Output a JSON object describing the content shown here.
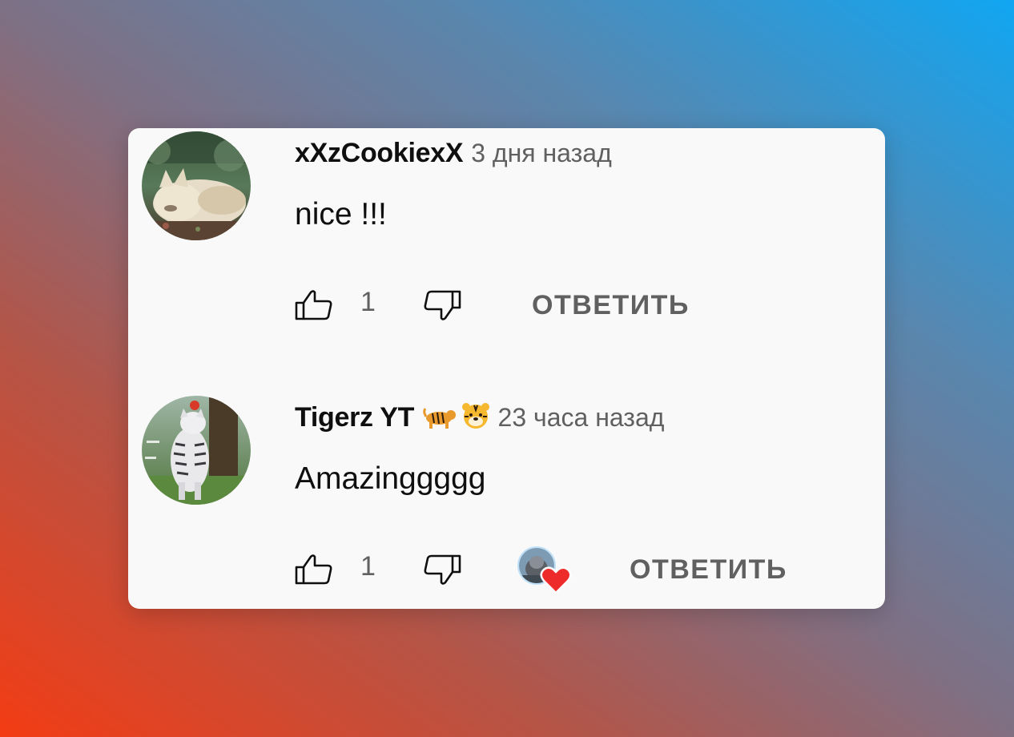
{
  "comments": [
    {
      "author": "xXzCookiexX",
      "time": "3 дня назад",
      "text": "nice !!!",
      "likes": "1",
      "reply_label": "ОТВЕТИТЬ",
      "avatar_icon": "wolf-avatar",
      "hearted": false
    },
    {
      "author": "Tigerz YT",
      "author_emoji": [
        "tiger-emoji",
        "tiger-face-emoji"
      ],
      "time": "23 часа назад",
      "text": "Amazinggggg",
      "likes": "1",
      "reply_label": "ОТВЕТИТЬ",
      "avatar_icon": "tiger-avatar",
      "hearted": true
    }
  ],
  "colors": {
    "card_bg": "#f9f9f9",
    "text_primary": "#0f0f0f",
    "text_secondary": "#606060",
    "heart": "#ee2b2b"
  }
}
